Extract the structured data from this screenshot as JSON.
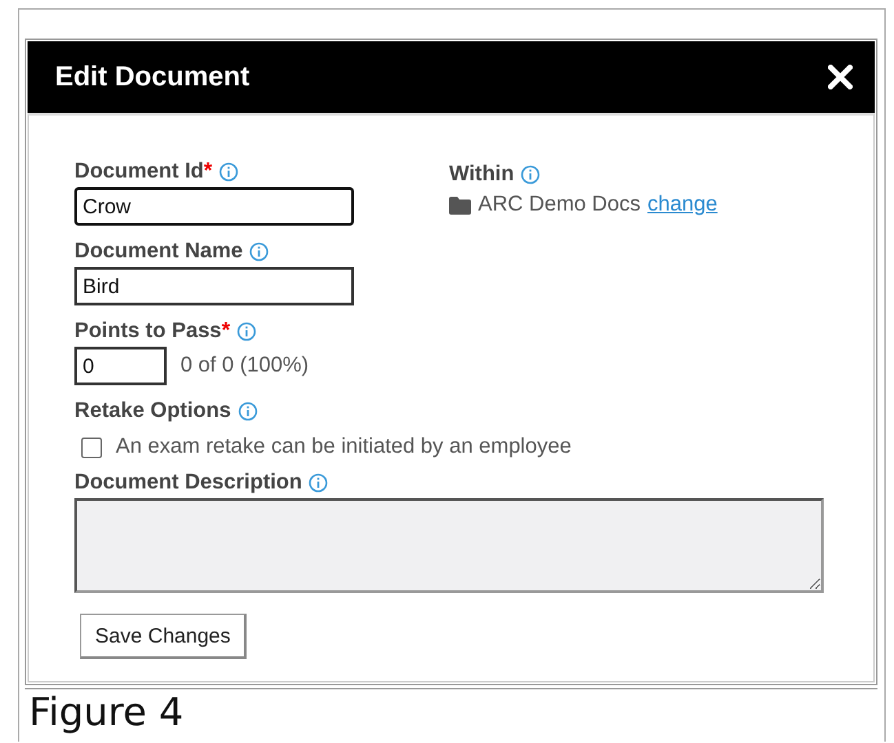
{
  "dialog": {
    "title": "Edit Document",
    "document_id": {
      "label": "Document Id",
      "required_mark": "*",
      "value": "Crow",
      "focused": true
    },
    "within": {
      "label": "Within",
      "folder": "ARC Demo Docs",
      "link": "change"
    },
    "document_name": {
      "label": "Document Name",
      "value": "Bird"
    },
    "points_to_pass": {
      "label": "Points to Pass",
      "required_mark": "*",
      "value": "0",
      "summary": "0 of 0 (100%)"
    },
    "retake_options": {
      "label": "Retake Options",
      "checkbox": {
        "label": "An exam retake can be initiated by an employee",
        "checked": false
      }
    },
    "document_description": {
      "label": "Document Description",
      "disabled": true
    },
    "save_button": "Save Changes"
  },
  "caption": "Figure 4"
}
